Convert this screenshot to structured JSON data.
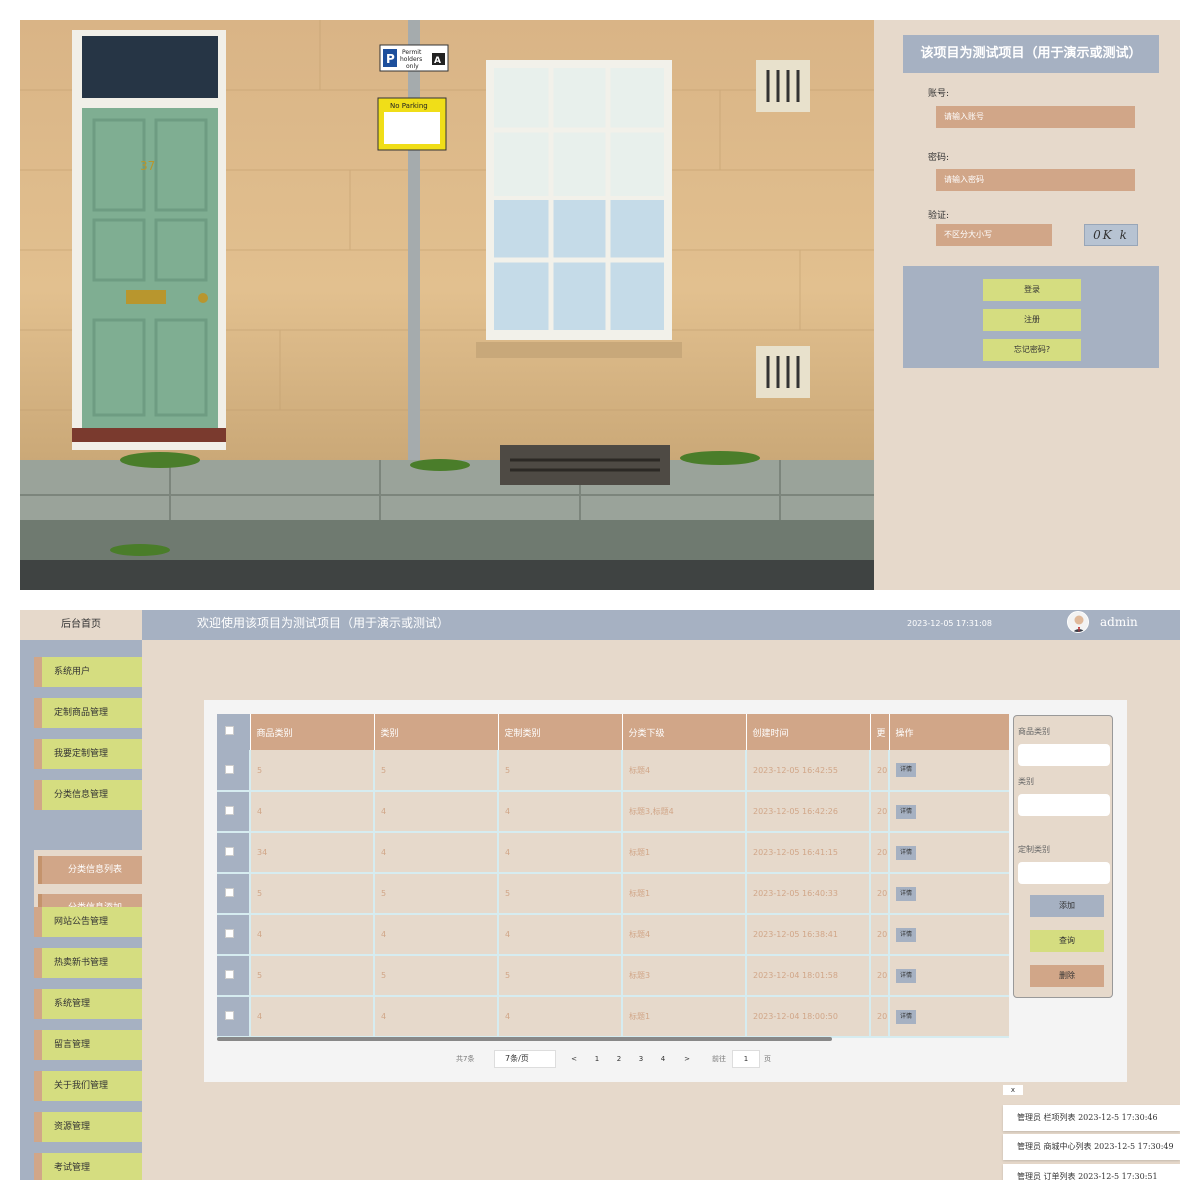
{
  "login": {
    "title": "该项目为测试项目（用于演示或测试）",
    "account_label": "账号:",
    "account_placeholder": "请输入账号",
    "password_label": "密码:",
    "password_placeholder": "请输入密码",
    "captcha_label": "验证:",
    "captcha_placeholder": "不区分大小写",
    "captcha_text": "0K k",
    "login_btn": "登录",
    "register_btn": "注册",
    "forgot_btn": "忘记密码?",
    "photo_signs": {
      "permit_line1": "Permit",
      "permit_line2": "holders",
      "permit_line3": "only",
      "permit_letter": "P",
      "permit_zone": "A",
      "no_parking": "No Parking",
      "door_number": "37"
    }
  },
  "admin": {
    "brand": "后台首页",
    "welcome": "欢迎使用该项目为测试项目（用于演示或测试）",
    "datetime": "2023-12-05 17:31:08",
    "username": "admin",
    "sidebar": {
      "items": [
        {
          "label": "系统用户"
        },
        {
          "label": "定制商品管理"
        },
        {
          "label": "我要定制管理"
        },
        {
          "label": "分类信息管理"
        },
        {
          "label": "网站公告管理"
        },
        {
          "label": "热卖新书管理"
        },
        {
          "label": "系统管理"
        },
        {
          "label": "留言管理"
        },
        {
          "label": "关于我们管理"
        },
        {
          "label": "资源管理"
        },
        {
          "label": "考试管理"
        }
      ],
      "subitems": [
        {
          "label": "分类信息列表"
        },
        {
          "label": "分类信息添加"
        }
      ]
    },
    "table": {
      "headers": [
        "商品类别",
        "类别",
        "定制类别",
        "分类下级",
        "创建时间",
        "更",
        "操作"
      ],
      "detail_label": "详情",
      "rows": [
        {
          "c1": "5",
          "c2": "5",
          "c3": "5",
          "c4": "标题4",
          "c5": "2023-12-05 16:42:55",
          "c6": "20"
        },
        {
          "c1": "4",
          "c2": "4",
          "c3": "4",
          "c4": "标题3,标题4",
          "c5": "2023-12-05 16:42:26",
          "c6": "20"
        },
        {
          "c1": "34",
          "c2": "4",
          "c3": "4",
          "c4": "标题1",
          "c5": "2023-12-05 16:41:15",
          "c6": "20"
        },
        {
          "c1": "5",
          "c2": "5",
          "c3": "5",
          "c4": "标题1",
          "c5": "2023-12-05 16:40:33",
          "c6": "20"
        },
        {
          "c1": "4",
          "c2": "4",
          "c3": "4",
          "c4": "标题4",
          "c5": "2023-12-05 16:38:41",
          "c6": "20"
        },
        {
          "c1": "5",
          "c2": "5",
          "c3": "5",
          "c4": "标题3",
          "c5": "2023-12-04 18:01:58",
          "c6": "20"
        },
        {
          "c1": "4",
          "c2": "4",
          "c3": "4",
          "c4": "标题1",
          "c5": "2023-12-04 18:00:50",
          "c6": "20"
        }
      ]
    },
    "pagination": {
      "total_label": "共7条",
      "page_size": "7条/页",
      "prev": "<",
      "pages": [
        "1",
        "2",
        "3",
        "4"
      ],
      "next": ">",
      "goto_label": "前往",
      "goto_value": "1",
      "page_suffix": "页"
    },
    "search": {
      "field1_label": "商品类别",
      "field2_label": "类别",
      "field3_label": "定制类别",
      "add_btn": "添加",
      "query_btn": "查询",
      "delete_btn": "删除"
    },
    "toasts": {
      "close": "x",
      "items": [
        "管理员 栏项列表 2023-12-5 17:30:46",
        "管理员 商城中心列表 2023-12-5 17:30:49",
        "管理员 订单列表 2023-12-5 17:30:51"
      ]
    }
  },
  "colors": {
    "tan": "#d1a688",
    "blue_gray": "#a6b1c2",
    "beige": "#e6d9cb",
    "lime": "#d5dd80"
  }
}
